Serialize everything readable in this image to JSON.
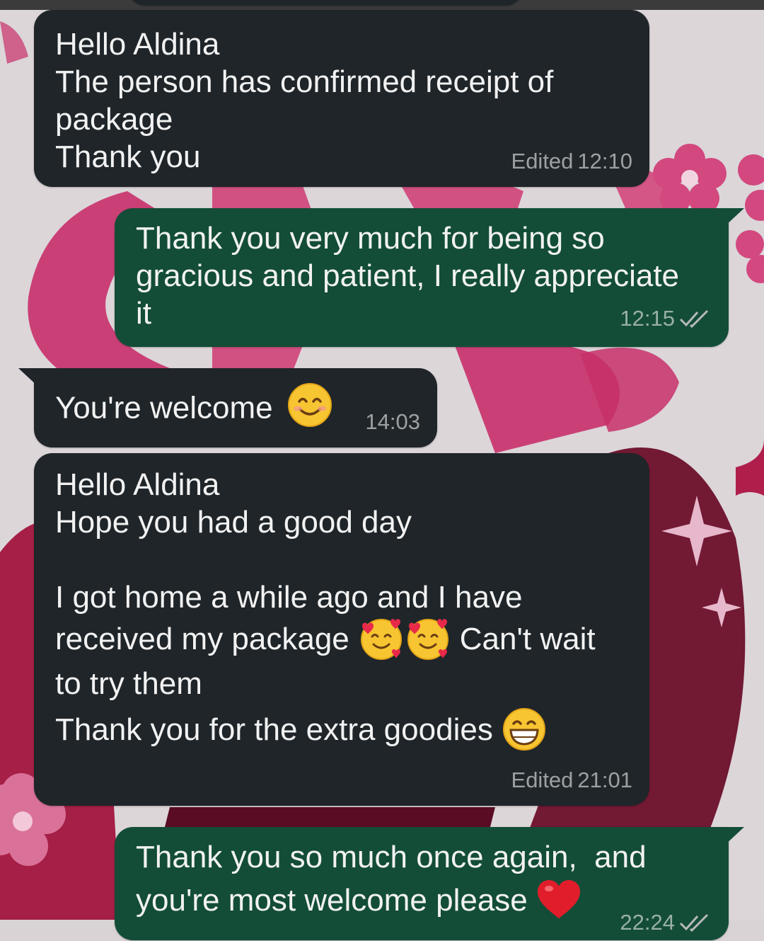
{
  "colors": {
    "incoming_bubble": "#1f2529",
    "outgoing_bubble": "#134d37",
    "text": "#f2f2f2",
    "meta": "#b7b9ba",
    "wallpaper_bg": "#d9d3d6",
    "wallpaper_accent": "#c8306a"
  },
  "messages": [
    {
      "direction": "incoming",
      "lines": [
        "Hello Aldina",
        "The person has confirmed receipt of",
        "package",
        "Thank you"
      ],
      "edited_label": "Edited",
      "time": "12:10"
    },
    {
      "direction": "outgoing",
      "lines": [
        "Thank you very much for being so",
        "gracious and patient, I really appreciate",
        "it"
      ],
      "time": "12:15",
      "status_icon": "double-check-icon"
    },
    {
      "direction": "incoming",
      "text": "You're welcome",
      "emoji": "smiling-face-icon",
      "time": "14:03"
    },
    {
      "direction": "incoming",
      "lines": [
        "Hello Aldina",
        "Hope you had a good day",
        "",
        "I got home a while ago and I have"
      ],
      "line5_before": "received my package",
      "line5_emojis": [
        "smiling-face-with-hearts-icon",
        "smiling-face-with-hearts-icon"
      ],
      "line5_after": "Can't wait",
      "line6": "to try them",
      "line7": "Thank you for the extra goodies",
      "line7_emoji": "grinning-face-icon",
      "edited_label": "Edited",
      "time": "21:01"
    },
    {
      "direction": "outgoing",
      "line1": "Thank you so much once again,  and",
      "line2": "you're most welcome please",
      "line2_emoji": "red-heart-icon",
      "time_partial": "22:24"
    }
  ]
}
